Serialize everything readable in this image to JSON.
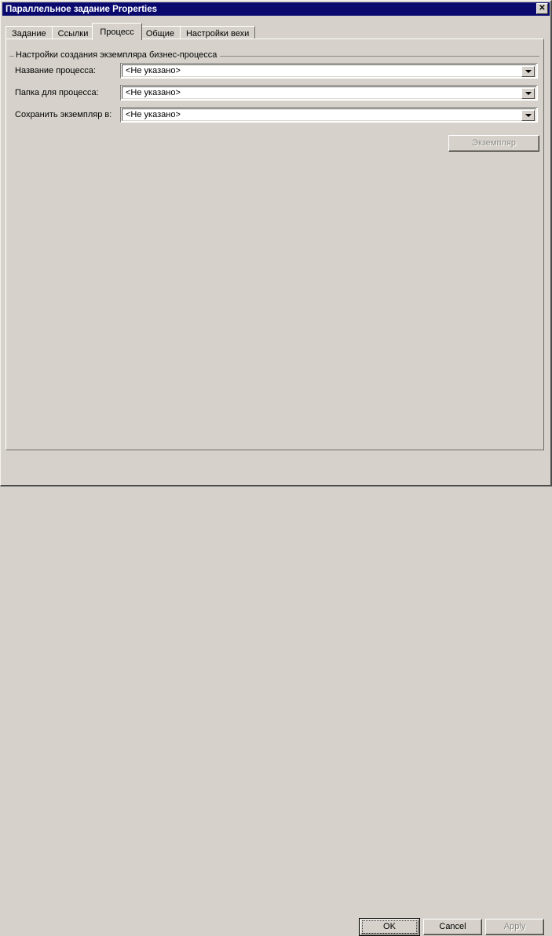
{
  "window": {
    "title": "Параллельное задание Properties",
    "close_button": {
      "name": "close",
      "glyph": "✕"
    },
    "colors": {
      "titlebar": "#0a0a6e",
      "face": "#d6d2cb",
      "shadow": "#45433e",
      "highlight": "#ffffff",
      "disabled_text": "#8a8782",
      "field": "#ffffff"
    }
  },
  "tabs": [
    {
      "label": "Задание",
      "active": false
    },
    {
      "label": "Ссылки",
      "active": false
    },
    {
      "label": "Процесс",
      "active": true
    },
    {
      "label": "Общие",
      "active": false
    },
    {
      "label": "Настройки вехи",
      "active": false
    }
  ],
  "groupbox": {
    "legend": "Настройки создания экземпляра бизнес-процесса"
  },
  "fields": [
    {
      "label": "Название процесса:",
      "value": "<Не указано>",
      "placeholder": "<Не указано>",
      "control": "combobox"
    },
    {
      "label": "Папка для процесса:",
      "value": "<Не указано>",
      "placeholder": "<Не указано>",
      "control": "combobox"
    },
    {
      "label": "Сохранить экземпляр в:",
      "value": "<Не указано>",
      "placeholder": "<Не указано>",
      "control": "combobox"
    }
  ],
  "instance_button": {
    "label": "Экземпляр",
    "enabled": false
  },
  "footer": {
    "ok": {
      "label": "OK",
      "enabled": true,
      "default": true
    },
    "cancel": {
      "label": "Cancel",
      "enabled": true,
      "default": false
    },
    "apply": {
      "label": "Apply",
      "enabled": false,
      "default": false
    }
  }
}
